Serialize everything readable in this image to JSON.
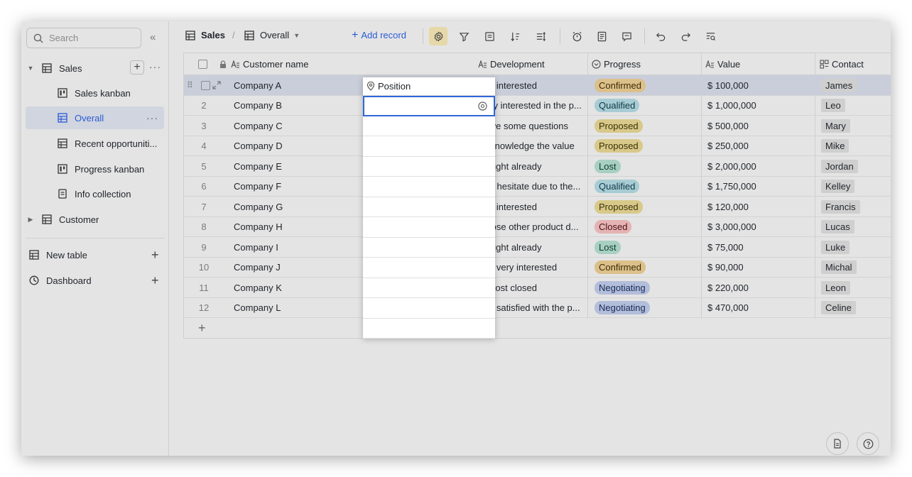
{
  "sidebar": {
    "search_placeholder": "Search",
    "sales": {
      "label": "Sales"
    },
    "views": [
      {
        "label": "Sales kanban"
      },
      {
        "label": "Overall"
      },
      {
        "label": "Recent opportuniti..."
      },
      {
        "label": "Progress kanban"
      },
      {
        "label": "Info collection"
      }
    ],
    "customer": {
      "label": "Customer"
    },
    "new_table": "New table",
    "dashboard": "Dashboard"
  },
  "toolbar": {
    "table": "Sales",
    "separator": "/",
    "view": "Overall",
    "add_record": "Add record"
  },
  "grid": {
    "columns": {
      "customer": "Customer name",
      "position": "Position",
      "development": "Development",
      "progress": "Progress",
      "value": "Value",
      "contact": "Contact"
    },
    "rows": [
      {
        "num": "1",
        "customer": "Company A",
        "development": "Not interested",
        "progress": "Confirmed",
        "value": "$ 100,000",
        "contact": "James"
      },
      {
        "num": "2",
        "customer": "Company B",
        "development": "Very interested in the p...",
        "progress": "Qualified",
        "value": "$ 1,000,000",
        "contact": "Leo"
      },
      {
        "num": "3",
        "customer": "Company C",
        "development": "Have some questions",
        "progress": "Proposed",
        "value": "$ 500,000",
        "contact": "Mary"
      },
      {
        "num": "4",
        "customer": "Company D",
        "development": "Acknowledge the value",
        "progress": "Proposed",
        "value": "$ 250,000",
        "contact": "Mike"
      },
      {
        "num": "5",
        "customer": "Company E",
        "development": "Bought already",
        "progress": "Lost",
        "value": "$ 2,000,000",
        "contact": "Jordan"
      },
      {
        "num": "6",
        "customer": "Company F",
        "development": "Still hesitate due to the...",
        "progress": "Qualified",
        "value": "$ 1,750,000",
        "contact": "Kelley"
      },
      {
        "num": "7",
        "customer": "Company G",
        "development": "Not interested",
        "progress": "Proposed",
        "value": "$ 120,000",
        "contact": "Francis"
      },
      {
        "num": "8",
        "customer": "Company H",
        "development": "Chose other product d...",
        "progress": "Closed",
        "value": "$ 3,000,000",
        "contact": "Lucas"
      },
      {
        "num": "9",
        "customer": "Company I",
        "development": "Bought already",
        "progress": "Lost",
        "value": "$ 75,000",
        "contact": "Luke"
      },
      {
        "num": "10",
        "customer": "Company J",
        "development": "Not very interested",
        "progress": "Confirmed",
        "value": "$ 90,000",
        "contact": "Michal"
      },
      {
        "num": "11",
        "customer": "Company K",
        "development": "Almost closed",
        "progress": "Negotiating",
        "value": "$ 220,000",
        "contact": "Leon"
      },
      {
        "num": "12",
        "customer": "Company L",
        "development": "Not satisfied with the p...",
        "progress": "Negotiating",
        "value": "$ 470,000",
        "contact": "Celine"
      }
    ]
  },
  "progress_colors": {
    "Confirmed": {
      "bg": "#dcc08a",
      "fg": "#3d2b06"
    },
    "Qualified": {
      "bg": "#a8ccd4",
      "fg": "#0f3a47"
    },
    "Proposed": {
      "bg": "#d8c98a",
      "fg": "#3b3006"
    },
    "Lost": {
      "bg": "#a8d0c2",
      "fg": "#0b3b2c"
    },
    "Closed": {
      "bg": "#e5b3b3",
      "fg": "#4a1212"
    },
    "Negotiating": {
      "bg": "#b3bedb",
      "fg": "#1a2a56"
    }
  },
  "accent_color": "#2a5cd4"
}
